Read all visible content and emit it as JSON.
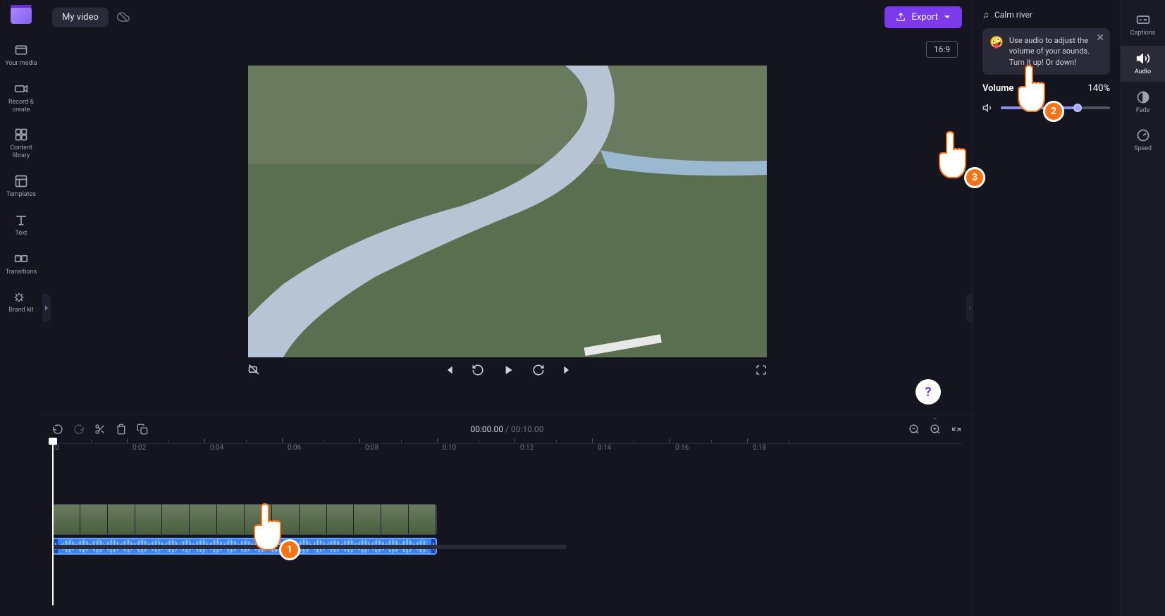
{
  "sidebar_left": {
    "items": [
      {
        "icon": "media",
        "label": "Your media"
      },
      {
        "icon": "camera",
        "label": "Record & create"
      },
      {
        "icon": "library",
        "label": "Content library"
      },
      {
        "icon": "templates",
        "label": "Templates"
      },
      {
        "icon": "text",
        "label": "Text"
      },
      {
        "icon": "transitions",
        "label": "Transitions"
      },
      {
        "icon": "brand",
        "label": "Brand kit"
      }
    ]
  },
  "topbar": {
    "project_name": "My video",
    "export_label": "Export"
  },
  "preview": {
    "aspect_ratio": "16:9"
  },
  "timeline": {
    "current_time": "00:00.00",
    "duration": "00:10.00",
    "ticks": [
      "0",
      "0:02",
      "0:04",
      "0:06",
      "0:08",
      "0:10",
      "0:12",
      "0:14",
      "0:16",
      "0:18"
    ]
  },
  "audio_panel": {
    "track_name": "Calm river",
    "tip_text": "Use audio to adjust the volume of your sounds. Turn it up! Or down!",
    "volume_label": "Volume",
    "volume_value": "140%"
  },
  "sidebar_right": {
    "items": [
      {
        "icon": "cc",
        "label": "Captions"
      },
      {
        "icon": "speaker",
        "label": "Audio"
      },
      {
        "icon": "fade",
        "label": "Fade"
      },
      {
        "icon": "speed",
        "label": "Speed"
      }
    ]
  },
  "annotations": {
    "hand1": "1",
    "hand2": "2",
    "hand3": "3"
  }
}
